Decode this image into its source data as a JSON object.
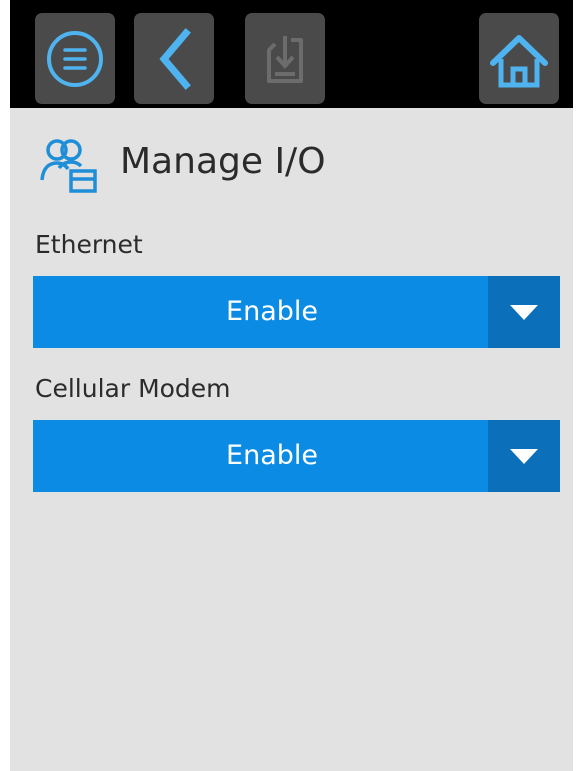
{
  "toolbar": {
    "menu_icon": "menu-circle-icon",
    "back_icon": "chevron-left-icon",
    "save_icon": "save-download-icon",
    "home_icon": "home-icon"
  },
  "page": {
    "title": "Manage I/O",
    "icon": "users-manage-icon"
  },
  "fields": [
    {
      "label": "Ethernet",
      "value": "Enable"
    },
    {
      "label": "Cellular Modem",
      "value": "Enable"
    }
  ],
  "colors": {
    "accent": "#0b8be3",
    "accent_dark": "#0b6fb9",
    "icon_blue": "#4fb3f0",
    "background": "#e2e2e2",
    "topbar": "#000000"
  }
}
